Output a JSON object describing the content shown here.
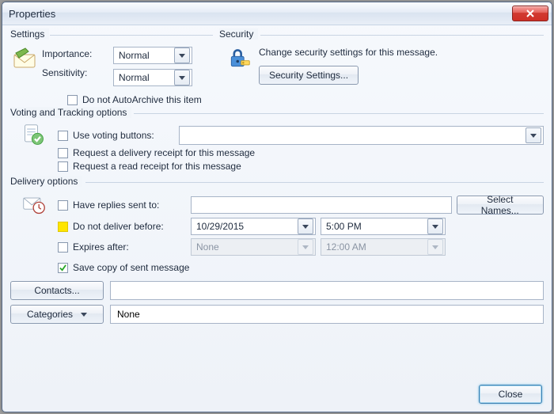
{
  "window": {
    "title": "Properties"
  },
  "settings": {
    "legend": "Settings",
    "importance_label": "Importance:",
    "sensitivity_label": "Sensitivity:",
    "importance_value": "Normal",
    "sensitivity_value": "Normal",
    "autoarchive_label": "Do not AutoArchive this item",
    "autoarchive_checked": false
  },
  "security": {
    "legend": "Security",
    "description": "Change security settings for this message.",
    "button_label": "Security Settings..."
  },
  "voting": {
    "legend": "Voting and Tracking options",
    "use_voting_label": "Use voting buttons:",
    "use_voting_checked": false,
    "voting_value": "",
    "delivery_receipt_label": "Request a delivery receipt for this message",
    "delivery_receipt_checked": false,
    "read_receipt_label": "Request a read receipt for this message",
    "read_receipt_checked": false
  },
  "delivery": {
    "legend": "Delivery options",
    "replies_label": "Have replies sent to:",
    "replies_checked": false,
    "replies_value": "",
    "select_names_label": "Select Names...",
    "not_before_label": "Do not deliver before:",
    "not_before_date": "10/29/2015",
    "not_before_time": "5:00 PM",
    "expires_label": "Expires after:",
    "expires_checked": false,
    "expires_date": "None",
    "expires_time": "12:00 AM",
    "save_copy_label": "Save copy of sent message",
    "save_copy_checked": true
  },
  "contacts": {
    "button_label": "Contacts...",
    "value": ""
  },
  "categories": {
    "button_label": "Categories",
    "value": "None"
  },
  "footer": {
    "close_label": "Close"
  }
}
